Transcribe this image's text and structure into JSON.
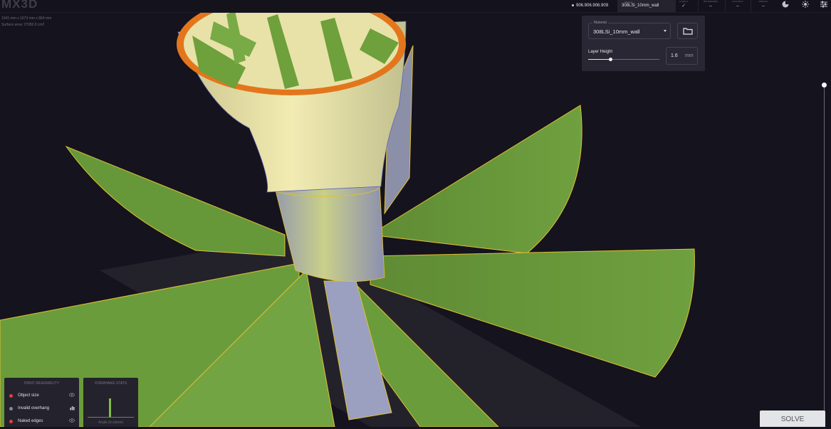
{
  "app": {
    "logo": "MX3D",
    "stats": [
      "1041 mm x 1673 mm x 864 mm",
      "Surface area: 27082.9 cm2"
    ]
  },
  "topbar": {
    "file_id": "906.906.906.909",
    "material_chip_label": "Material",
    "material_chip": "308LSi_10mm_wall",
    "checks": [
      {
        "label": "LAYER S",
        "value": "✓"
      },
      {
        "label": "BOUNDARIES",
        "value": "–"
      },
      {
        "label": "COLORS S",
        "value": "–"
      },
      {
        "label": "SPECIAL",
        "value": "–"
      }
    ],
    "icons": [
      "pie-chart-icon",
      "sun-icon",
      "sliders-icon"
    ]
  },
  "settings": {
    "material_label": "Material",
    "material_value": "308LSi_10mm_wall",
    "layer_height_label": "Layer Height",
    "layer_height_value": "1.6",
    "layer_height_unit": "mm",
    "layer_height_fraction": 0.31
  },
  "print_readability": {
    "title": "PRINT READABILITY",
    "items": [
      {
        "label": "Object size",
        "status_color": "#e0413a",
        "icon": "eye-icon"
      },
      {
        "label": "Invalid overhang",
        "status_color": "#8a8894",
        "icon": "bar-chart-icon"
      },
      {
        "label": "Naked edges",
        "status_color": "#e0413a",
        "icon": "eye-icon"
      }
    ]
  },
  "overhang": {
    "title": "OVERHANG STATS",
    "footer": "Angle (in plane)"
  },
  "solve_label": "SOLVE",
  "colors": {
    "surface": "#6ea03c",
    "edge": "#e2c032",
    "rim": "#e3761c",
    "background": "#15131d"
  }
}
